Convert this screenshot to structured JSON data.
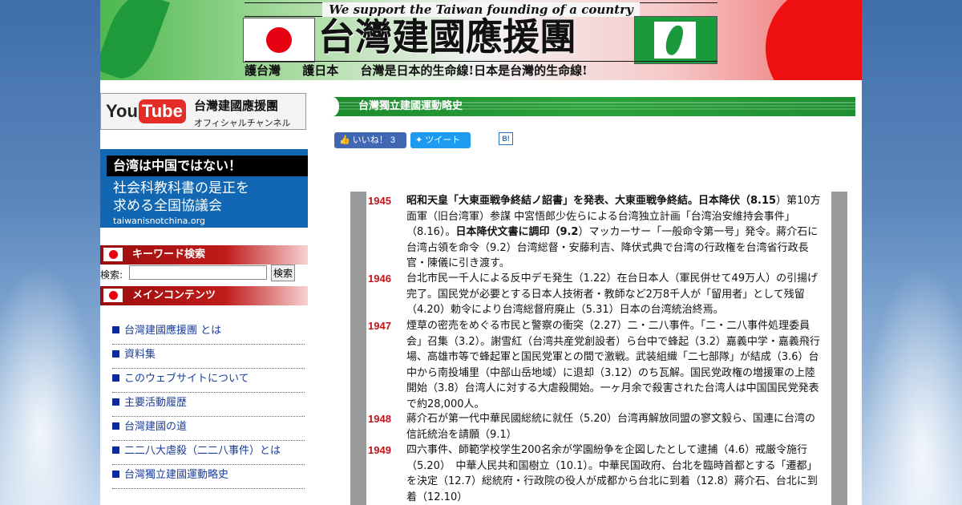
{
  "banner": {
    "slogan_top": "We support the Taiwan founding of a country",
    "title": "台灣建國應援團",
    "sub_1": "護台灣",
    "sub_2": "護日本",
    "sub_3": "台灣是日本的生命線!日本是台灣的生命線!"
  },
  "youtube": {
    "logo_you": "You",
    "logo_tube": "Tube",
    "title": "台灣建國應援團",
    "subtitle": "オフィシャルチャンネル"
  },
  "twbox": {
    "head": "台湾は中国ではない！",
    "line1": "社会科教科書の是正を",
    "line2": "求める全国協議会",
    "url": "taiwanisnotchina.org"
  },
  "search": {
    "section": "キーワード検索",
    "label": "検索:",
    "value": "",
    "button": "検索"
  },
  "menu": {
    "section": "メインコンテンツ",
    "items": [
      "台灣建國應援團 とは",
      "資料集",
      "このウェブサイトについて",
      "主要活動履歴",
      "台灣建國の道",
      "二二八大虐殺（二二八事件）とは",
      "台灣獨立建國運動略史"
    ]
  },
  "main": {
    "heading": "台灣獨立建國運動略史",
    "fb_label": "いいね！ 3",
    "tw_label": "ツイート",
    "hb_label": "B!"
  },
  "timeline": [
    {
      "year": "1945",
      "bold1": "昭和天皇「大東亜戦争終結ノ詔書」を発表、大東亜戦争終結。日本降伏（8.15",
      "text1": "）第10方面軍（旧台湾軍）参謀 中宮悟郎少佐らによる台湾独立計画「台湾治安維持会事件」（8.16）。",
      "bold2": "日本降伏文書に調印（9.2",
      "text2": "）マッカーサー「一般命令第一号」発令。蔣介石に台湾占領を命令（9.2）台湾総督・安藤利吉、降伏式典で台湾の行政権を台湾省行政長官・陳儀に引き渡す。"
    },
    {
      "year": "1946",
      "text1": "台北市民一千人による反中デモ発生（1.22）在台日本人（軍民併せて49万人）の引揚げ完了。国民党が必要とする日本人技術者・教師など2万8千人が「留用者」として残留（4.20）勅令により台湾総督府廃止（5.31）日本の台湾統治終焉。"
    },
    {
      "year": "1947",
      "text1": "煙草の密売をめぐる市民と警察の衝突（2.27）二・二八事件。「二・二八事件処理委員会」召集（3.2）。謝雪紅（台湾共産党創設者）ら台中で蜂起（3.2）嘉義中学・嘉義飛行場、高雄市等で蜂起軍と国民党軍との間で激戦。武装組織「二七部隊」が結成（3.6）台中から南投埔里（中部山岳地域）に退却（3.12）のち瓦解。国民党政権の増援軍の上陸開始（3.8）台湾人に対する大虐殺開始。一ヶ月余で殺害された台湾人は中国国民党発表で約28,000人。"
    },
    {
      "year": "1948",
      "text1": "蔣介石が第一代中華民國総統に就任（5.20）台湾再解放同盟の寥文毅ら、国連に台湾の信託統治を請願（9.1）"
    },
    {
      "year": "1949",
      "text1": "四六事件、師範学校学生200名余が学園紛争を企図したとして逮捕（4.6）戒厳令施行（5.20）　中華人民共和国樹立（10.1）。中華民国政府、台北を臨時首都とする「遷都」を決定（12.7）総統府・行政院の役人が成都から台北に到着（12.8）蔣介石、台北に到着（12.10）"
    }
  ],
  "colors": {
    "year_red": "#c0141c",
    "menu_link": "#1a3d9a",
    "heading_green": "#1c8a2c",
    "section_red": "#9b0d0d"
  }
}
